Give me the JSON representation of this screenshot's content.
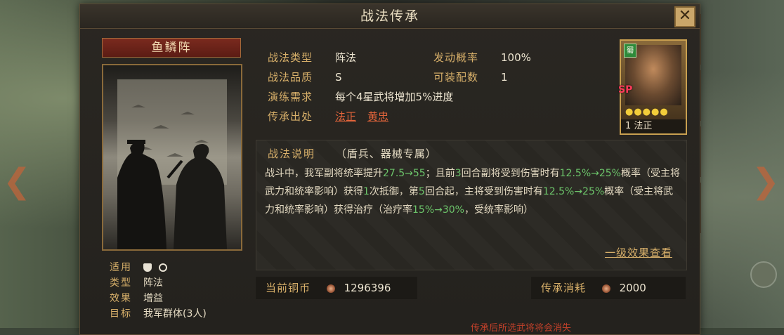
{
  "header": {
    "title": "战法传承",
    "close_label": "✕"
  },
  "tactic": {
    "name": "鱼鳞阵",
    "meta": [
      {
        "key": "适用",
        "value": ""
      },
      {
        "key": "类型",
        "value": "阵法"
      },
      {
        "key": "效果",
        "value": "增益"
      },
      {
        "key": "目标",
        "value": "我军群体(3人)"
      }
    ],
    "apply_icons": [
      "shield-icon",
      "gear-icon"
    ]
  },
  "info": {
    "type_label": "战法类型",
    "type_value": "阵法",
    "rate_label": "发动概率",
    "rate_value": "100%",
    "quality_label": "战法品质",
    "quality_value": "S",
    "slots_label": "可装配数",
    "slots_value": "1",
    "drill_label": "演练需求",
    "drill_value": "每个4星武将增加5%进度",
    "source_label": "传承出处",
    "sources": [
      "法正",
      "黄忠"
    ]
  },
  "hero_card": {
    "faction": "蜀",
    "tag": "SP",
    "stars": "●●●●●",
    "level": "1",
    "name": "法正"
  },
  "description": {
    "title": "战法说明",
    "scope": "（盾兵、器械专属）",
    "segments": [
      {
        "t": "战斗中，我军副将统率提升",
        "c": ""
      },
      {
        "t": "27.5→55",
        "c": "g"
      },
      {
        "t": "；且前",
        "c": ""
      },
      {
        "t": "3",
        "c": "g"
      },
      {
        "t": "回合副将受到伤害时有",
        "c": ""
      },
      {
        "t": "12.5%→25%",
        "c": "g"
      },
      {
        "t": "概率（受主将武力和统率影响）获得",
        "c": ""
      },
      {
        "t": "1",
        "c": "g"
      },
      {
        "t": "次抵御，第",
        "c": ""
      },
      {
        "t": "5",
        "c": "g"
      },
      {
        "t": "回合起，主将受到伤害时有",
        "c": ""
      },
      {
        "t": "12.5%→25%",
        "c": "g"
      },
      {
        "t": "概率（受主将武力和统率影响）获得治疗（治疗率",
        "c": ""
      },
      {
        "t": "15%→30%",
        "c": "g"
      },
      {
        "t": "，受统率影响）",
        "c": ""
      }
    ],
    "level_link": "一级效果查看"
  },
  "resources": {
    "coin_label": "当前铜币",
    "coin_value": "1296396",
    "cost_label": "传承消耗",
    "cost_value": "2000"
  },
  "footer_note": "传承后所选武将将会消失",
  "side_tabs": [
    "",
    "",
    "",
    ""
  ],
  "colors": {
    "accent": "#d8b06a",
    "link": "#e2643a",
    "highlight": "#6cc46a"
  }
}
